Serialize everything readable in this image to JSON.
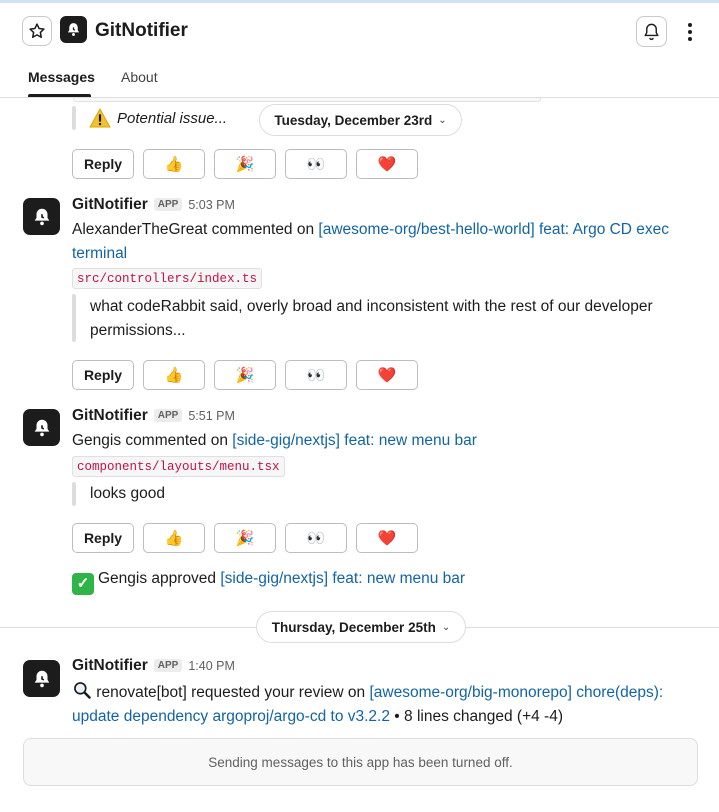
{
  "header": {
    "app_title": "GitNotifier",
    "star_icon": "star-icon",
    "bell_icon": "bell-icon",
    "more_icon": "more-vertical-icon"
  },
  "tabs": [
    {
      "label": "Messages",
      "active": true
    },
    {
      "label": "About",
      "active": false
    }
  ],
  "reactions": {
    "reply": "Reply",
    "thumbs": "👍",
    "party": "🎉",
    "eyes": "👀",
    "heart": "❤️"
  },
  "feed": {
    "truncated": {
      "warning_icon": "warning-icon",
      "text": "Potential issue..."
    },
    "date_1": "Tuesday, December 23rd",
    "messages": [
      {
        "sender": "GitNotifier",
        "badge": "APP",
        "time": "5:03 PM",
        "prefix": "AlexanderTheGreat commented on ",
        "link": "[awesome-org/best-hello-world] feat: Argo CD exec terminal",
        "file": "src/controllers/index.ts",
        "quote": "what codeRabbit said, overly broad and inconsistent with the rest of our developer permissions..."
      },
      {
        "sender": "GitNotifier",
        "badge": "APP",
        "time": "5:51 PM",
        "prefix": "Gengis commented on ",
        "link": "[side-gig/nextjs] feat: new menu bar",
        "file": "components/layouts/menu.tsx",
        "quote": "looks good",
        "approval_prefix": "Gengis approved ",
        "approval_link": "[side-gig/nextjs] feat: new menu bar"
      },
      {
        "sender": "GitNotifier",
        "badge": "APP",
        "time": "1:40 PM",
        "search_icon": "magnifier-icon",
        "prefix": " renovate[bot] requested your review on ",
        "link": "[awesome-org/big-monorepo] chore(deps): update dependency argoproj/argo-cd to v3.2.2",
        "suffix": " • 8 lines changed (+4 -4)"
      }
    ],
    "date_2": "Thursday, December 25th"
  },
  "notice": "Sending messages to this app has been turned off.",
  "colors": {
    "link": "#1264a3",
    "code_text": "#c01343",
    "approve_green": "#2fb447"
  }
}
